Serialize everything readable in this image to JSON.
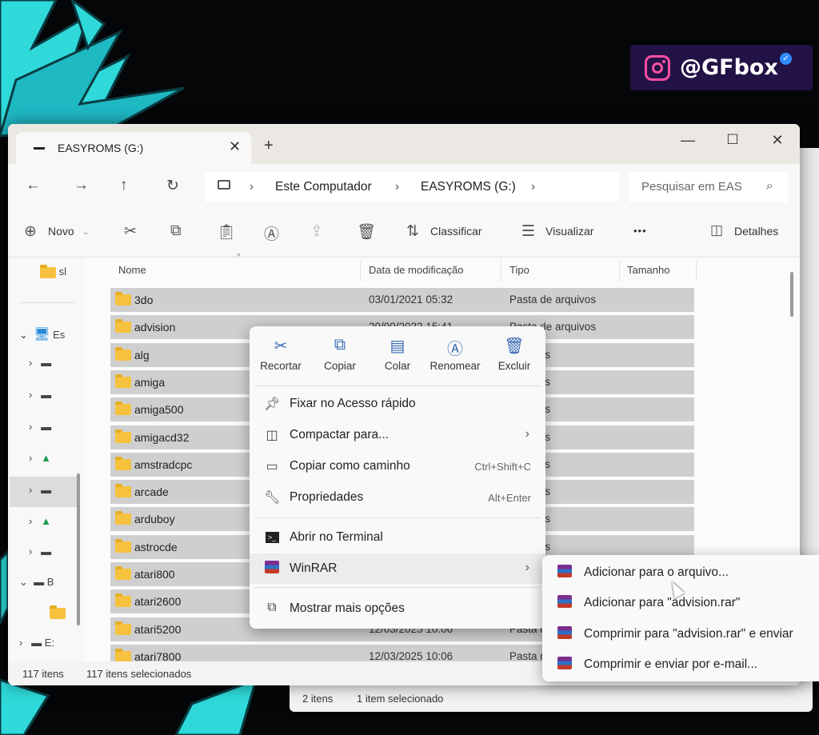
{
  "overlay": {
    "handle": "@GFbox"
  },
  "window": {
    "tab_title": "EASYROMS (G:)",
    "breadcrumb": [
      "Este Computador",
      "EASYROMS (G:)"
    ],
    "search_placeholder": "Pesquisar em EAS"
  },
  "toolbar": {
    "new_label": "Novo",
    "sort_label": "Classificar",
    "view_label": "Visualizar",
    "more_label": "•••",
    "details_label": "Detalhes"
  },
  "sidebar": {
    "quick_item": "sl",
    "pc_label": "Es",
    "b_label": "B",
    "e_label": "E:"
  },
  "columns": {
    "name": "Nome",
    "date": "Data de modificação",
    "type": "Tipo",
    "size": "Tamanho"
  },
  "rows": [
    {
      "name": "3do",
      "date": "03/01/2021 05:32",
      "type": "Pasta de arquivos"
    },
    {
      "name": "advision",
      "date": "20/00/2022 15:41",
      "type": "Pasta de arquivos"
    },
    {
      "name": "alg",
      "date": "",
      "type": "arquivos"
    },
    {
      "name": "amiga",
      "date": "",
      "type": "arquivos"
    },
    {
      "name": "amiga500",
      "date": "",
      "type": "arquivos"
    },
    {
      "name": "amigacd32",
      "date": "",
      "type": "arquivos"
    },
    {
      "name": "amstradcpc",
      "date": "",
      "type": "arquivos"
    },
    {
      "name": "arcade",
      "date": "",
      "type": "arquivos"
    },
    {
      "name": "arduboy",
      "date": "",
      "type": "arquivos"
    },
    {
      "name": "astrocde",
      "date": "",
      "type": "arquivos"
    },
    {
      "name": "atari800",
      "date": "",
      "type": ""
    },
    {
      "name": "atari2600",
      "date": "",
      "type": ""
    },
    {
      "name": "atari5200",
      "date": "12/03/2025 10:06",
      "type": "Pasta d"
    },
    {
      "name": "atari7800",
      "date": "12/03/2025 10:06",
      "type": "Pasta de"
    }
  ],
  "status": {
    "count": "117 itens",
    "selected": "117 itens selecionados"
  },
  "back_status": {
    "count": "2 itens",
    "selected": "1 item selecionado"
  },
  "context_menu": {
    "quick_actions": [
      {
        "label": "Recortar",
        "icon": "cut-icon"
      },
      {
        "label": "Copiar",
        "icon": "copy-icon"
      },
      {
        "label": "Colar",
        "icon": "paste-icon"
      },
      {
        "label": "Renomear",
        "icon": "rename-icon"
      },
      {
        "label": "Excluir",
        "icon": "delete-icon"
      }
    ],
    "items": {
      "pin": "Fixar no Acesso rápido",
      "compress": "Compactar para...",
      "copy_path": "Copiar como caminho",
      "copy_path_shortcut": "Ctrl+Shift+C",
      "properties": "Propriedades",
      "properties_shortcut": "Alt+Enter",
      "terminal": "Abrir no Terminal",
      "winrar": "WinRAR",
      "more": "Mostrar mais opções"
    }
  },
  "winrar_submenu": [
    "Adicionar para o arquivo...",
    "Adicionar para \"advision.rar\"",
    "Comprimir para \"advision.rar\" e enviar",
    "Comprimir e enviar por e-mail..."
  ]
}
